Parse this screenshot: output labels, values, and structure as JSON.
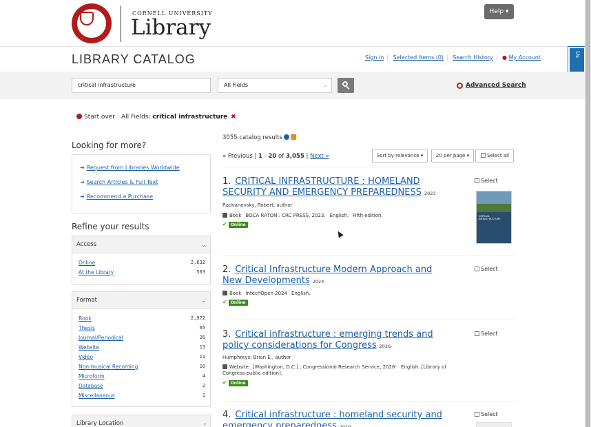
{
  "header": {
    "logo_university": "CORNELL UNIVERSITY",
    "logo_library": "Library",
    "help_label": "Help ▾",
    "page_title": "LIBRARY CATALOG",
    "links": {
      "sign_in": "Sign in",
      "selected_items": "Selected Items (0)",
      "search_history": "Search History",
      "my_account": "My Account"
    },
    "chat_tab": "Chat with Us"
  },
  "search": {
    "query": "critical infrastructure",
    "field": "All Fields",
    "advanced_label": "Advanced Search"
  },
  "constraints": {
    "start_over": "Start over",
    "field_label": "All Fields:",
    "value": "critical infrastructure"
  },
  "sidebar": {
    "looking_title": "Looking for more?",
    "more_links": [
      "Request from Libraries Worldwide",
      "Search Articles & Full Text",
      "Recommend a Purchase"
    ],
    "refine_title": "Refine your results",
    "facets": [
      {
        "name": "Access",
        "items": [
          {
            "label": "Online",
            "count": "2,632"
          },
          {
            "label": "At the Library",
            "count": "503"
          }
        ]
      },
      {
        "name": "Format",
        "items": [
          {
            "label": "Book",
            "count": "2,972"
          },
          {
            "label": "Thesis",
            "count": "65"
          },
          {
            "label": "Journal/Periodical",
            "count": "26"
          },
          {
            "label": "Website",
            "count": "13"
          },
          {
            "label": "Video",
            "count": "11"
          },
          {
            "label": "Non-musical Recording",
            "count": "10"
          },
          {
            "label": "Microform",
            "count": "4"
          },
          {
            "label": "Database",
            "count": "2"
          },
          {
            "label": "Miscellaneous",
            "count": "1"
          }
        ]
      },
      {
        "name": "Library Location",
        "items": []
      }
    ]
  },
  "results_header": {
    "count": "3055 catalog results",
    "prev": "« Previous",
    "range_start": "1",
    "range_end": "20",
    "total": "3,055",
    "next": "Next »",
    "sort_label": "Sort by relevance ▾",
    "per_page_label": "20 per page ▾",
    "select_all_label": "Select all"
  },
  "results": [
    {
      "num": "1.",
      "title": "CRITICAL INFRASTRUCTURE : HOMELAND SECURITY AND EMERGENCY PREPAREDNESS",
      "year": "2023",
      "author": "Radvanovsky, Robert, author",
      "format": "Book",
      "publisher": "BOCA RATON : CRC PRESS, 2023.",
      "language": "English.",
      "extra": "Fifth edition.",
      "online_badge": "Online",
      "select_label": "Select",
      "cover_text": "CRITICAL INFRASTRUCTURE"
    },
    {
      "num": "2.",
      "title": "Critical Infrastructure Modern Approach and New Developments",
      "year": "2024",
      "format": "Book",
      "publisher": "IntechOpen 2024",
      "language": "English.",
      "online_badge": "Online",
      "select_label": "Select"
    },
    {
      "num": "3.",
      "title": "Critical infrastructure : emerging trends and policy considerations for Congress",
      "year": "2026-",
      "author": "Humphreys, Brian E., author",
      "format": "Website",
      "publisher": "[Washington, D.C.] : Congressional Research Service, 2026-",
      "language": "English.",
      "extra": "[Library of Congress public edition].",
      "online_badge": "Online",
      "select_label": "Select"
    },
    {
      "num": "4.",
      "title": "Critical infrastructure : homeland security and emergency preparedness",
      "year": "2019",
      "select_label": "Select"
    }
  ]
}
